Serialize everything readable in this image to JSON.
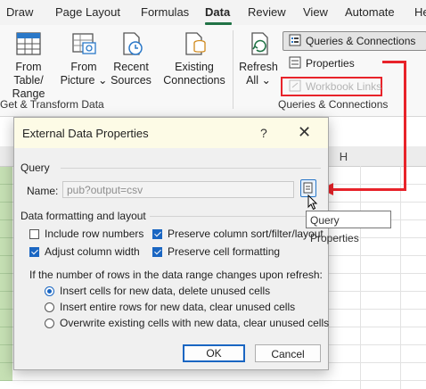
{
  "ribbon_tabs": [
    "Draw",
    "Page Layout",
    "Formulas",
    "Data",
    "Review",
    "View",
    "Automate",
    "He"
  ],
  "active_tab": "Data",
  "get_transform": {
    "from_table_line1": "From Table/",
    "from_table_line2": "Range",
    "from_picture_line1": "From",
    "from_picture_line2": "Picture ⌄",
    "recent_sources_line1": "Recent",
    "recent_sources_line2": "Sources",
    "existing_connections_line1": "Existing",
    "existing_connections_line2": "Connections",
    "group_label": "Get & Transform Data"
  },
  "queries": {
    "refresh_line1": "Refresh",
    "refresh_line2": "All ⌄",
    "queries_connections": "Queries & Connections",
    "properties": "Properties",
    "workbook_links": "Workbook Links",
    "group_label": "Queries & Connections"
  },
  "sheet": {
    "column_h": "H"
  },
  "dialog": {
    "title": "External Data Properties",
    "help": "?",
    "close": "✕",
    "query_section": "Query",
    "name_label": "Name:",
    "name_value": "pub?output=csv",
    "formatting_section": "Data formatting and layout",
    "include_row_numbers": "Include row numbers",
    "adjust_column_width": "Adjust column width",
    "preserve_sort": "Preserve column sort/filter/layout",
    "preserve_cell_formatting": "Preserve cell formatting",
    "refresh_question": "If the number of rows in the data range changes upon refresh:",
    "radio_insert_cells": "Insert cells for new data, delete unused cells",
    "radio_insert_rows": "Insert entire rows for new data, clear unused cells",
    "radio_overwrite": "Overwrite existing cells with new data, clear unused cells",
    "ok": "OK",
    "cancel": "Cancel"
  },
  "tooltip": "Query Properties",
  "colors": {
    "accent": "#1a66c2",
    "annotation_red": "#e8232a",
    "excel_green": "#217346",
    "selected_cell_green": "#c6e0b4"
  }
}
